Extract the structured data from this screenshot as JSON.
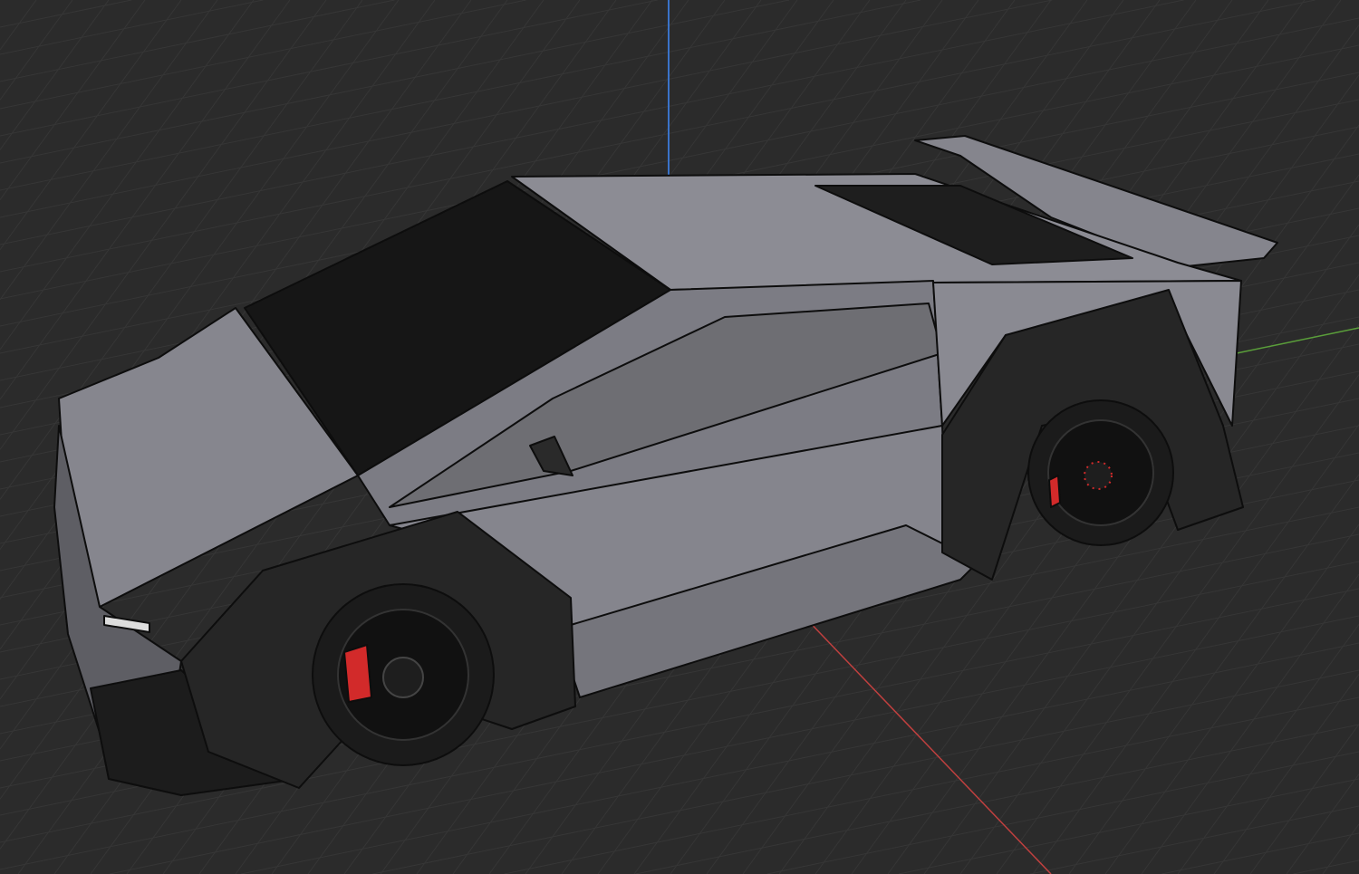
{
  "viewport": {
    "background_color": "#2b2b2b",
    "grid_color": "#363636",
    "axis_colors": {
      "x": "#c0403f",
      "y": "#5a9e3a",
      "z": "#3a73c9"
    }
  },
  "model": {
    "body_color": "#8a8a92",
    "body_shadow_color": "#6b6b72",
    "glass_color": "#161616",
    "trim_color": "#222222",
    "tire_color": "#1b1b1b",
    "brake_caliper_color": "#d22a2a"
  }
}
